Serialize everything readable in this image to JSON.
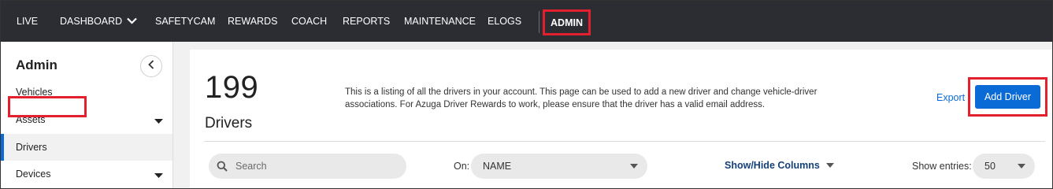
{
  "topnav": {
    "items": [
      {
        "label": "LIVE"
      },
      {
        "label": "DASHBOARD"
      },
      {
        "label": "SAFETYCAM"
      },
      {
        "label": "REWARDS"
      },
      {
        "label": "COACH"
      },
      {
        "label": "REPORTS"
      },
      {
        "label": "MAINTENANCE"
      },
      {
        "label": "ELOGS"
      }
    ],
    "active": {
      "label": "ADMIN"
    }
  },
  "sidebar": {
    "title": "Admin",
    "items": [
      {
        "label": "Vehicles"
      },
      {
        "label": "Assets"
      },
      {
        "label": "Drivers"
      },
      {
        "label": "Devices"
      }
    ]
  },
  "main": {
    "count": "199",
    "count_label": "Drivers",
    "description": "This is a listing of all the drivers in your account. This page can be used to add a new driver and change vehicle-driver associations. For Azuga Driver Rewards to work, please ensure that the driver has a valid email address.",
    "export_label": "Export",
    "add_button_label": "Add Driver"
  },
  "toolbar": {
    "search_placeholder": "Search",
    "on_label": "On:",
    "on_value": "NAME",
    "show_hide_label": "Show/Hide Columns",
    "entries_label": "Show entries:",
    "entries_value": "50"
  },
  "colors": {
    "nav_bg": "#2b2d33",
    "accent_blue": "#0b6bd6",
    "highlight_red": "#e3202e"
  }
}
